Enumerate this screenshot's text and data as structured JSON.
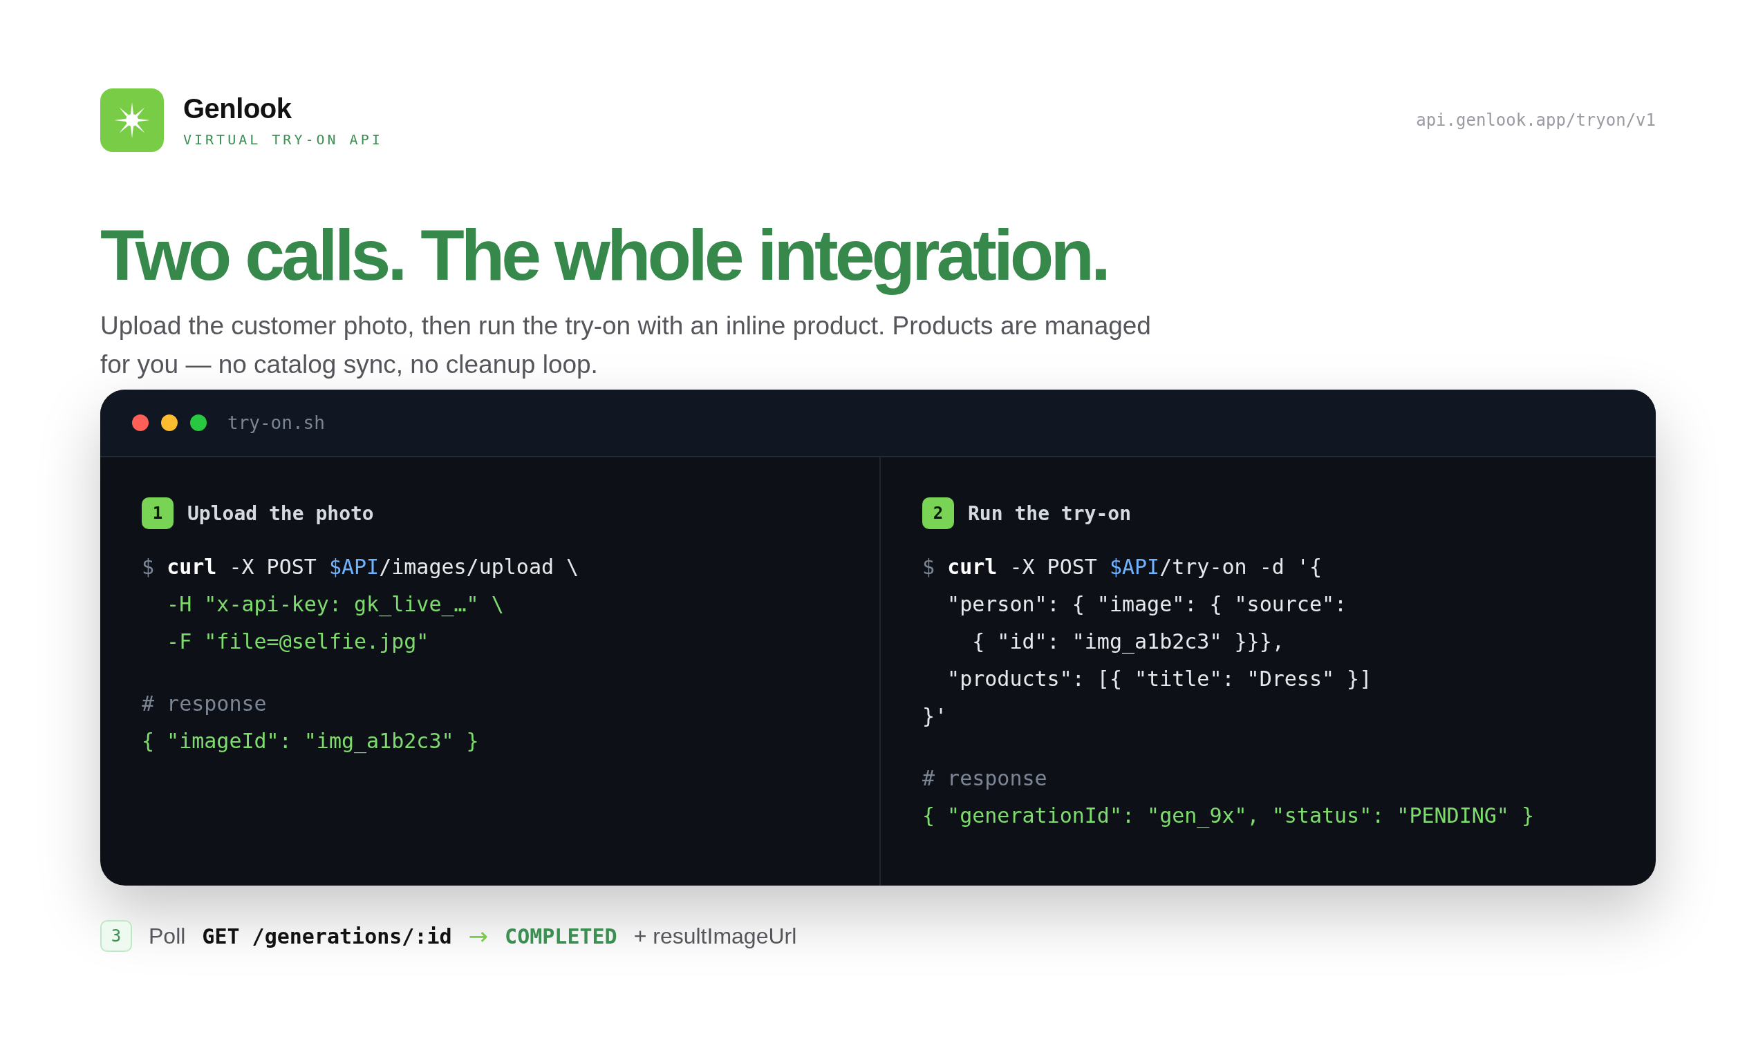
{
  "brand": {
    "name": "Genlook",
    "tagline": "VIRTUAL TRY-ON API"
  },
  "endpoint": "api.genlook.app/tryon/v1",
  "headline": "Two calls. The whole integration.",
  "intro": "Upload the customer photo, then run the try-on with an inline product. Products are managed for you — no catalog sync, no cleanup loop.",
  "terminal": {
    "filename": "try-on.sh",
    "steps": [
      {
        "number": "1",
        "title": "Upload the photo",
        "command": [
          [
            {
              "kind": "prompt",
              "text": "$ "
            },
            {
              "kind": "cmd",
              "text": "curl"
            },
            {
              "kind": "plain",
              "text": " -X POST "
            },
            {
              "kind": "var",
              "text": "$API"
            },
            {
              "kind": "plain",
              "text": "/images/upload \\"
            }
          ],
          [
            {
              "kind": "string",
              "text": "  -H \"x-api-key: gk_live_…\" \\"
            }
          ],
          [
            {
              "kind": "string",
              "text": "  -F \"file=@selfie.jpg\""
            }
          ]
        ],
        "response": [
          [
            {
              "kind": "comment",
              "text": "# response"
            }
          ],
          [
            {
              "kind": "string",
              "text": "{ \"imageId\": \"img_a1b2c3\" }"
            }
          ]
        ]
      },
      {
        "number": "2",
        "title": "Run the try-on",
        "command": [
          [
            {
              "kind": "prompt",
              "text": "$ "
            },
            {
              "kind": "cmd",
              "text": "curl"
            },
            {
              "kind": "plain",
              "text": " -X POST "
            },
            {
              "kind": "var",
              "text": "$API"
            },
            {
              "kind": "plain",
              "text": "/try-on -d '{"
            }
          ],
          [
            {
              "kind": "plain",
              "text": "  \"person\": { \"image\": { \"source\":"
            }
          ],
          [
            {
              "kind": "plain",
              "text": "    { \"id\": \"img_a1b2c3\" }}},"
            }
          ],
          [
            {
              "kind": "plain",
              "text": "  \"products\": [{ \"title\": \"Dress\" }]"
            }
          ],
          [
            {
              "kind": "plain",
              "text": "}'"
            }
          ]
        ],
        "response": [
          [
            {
              "kind": "comment",
              "text": "# response"
            }
          ],
          [
            {
              "kind": "string",
              "text": "{ \"generationId\": \"gen_9x\", \"status\": \"PENDING\" }"
            }
          ]
        ]
      }
    ]
  },
  "footer_step": {
    "number": "3",
    "label": "Poll",
    "request": "GET /generations/:id",
    "arrow": "→",
    "status": "COMPLETED",
    "extra": "+ resultImageUrl"
  }
}
